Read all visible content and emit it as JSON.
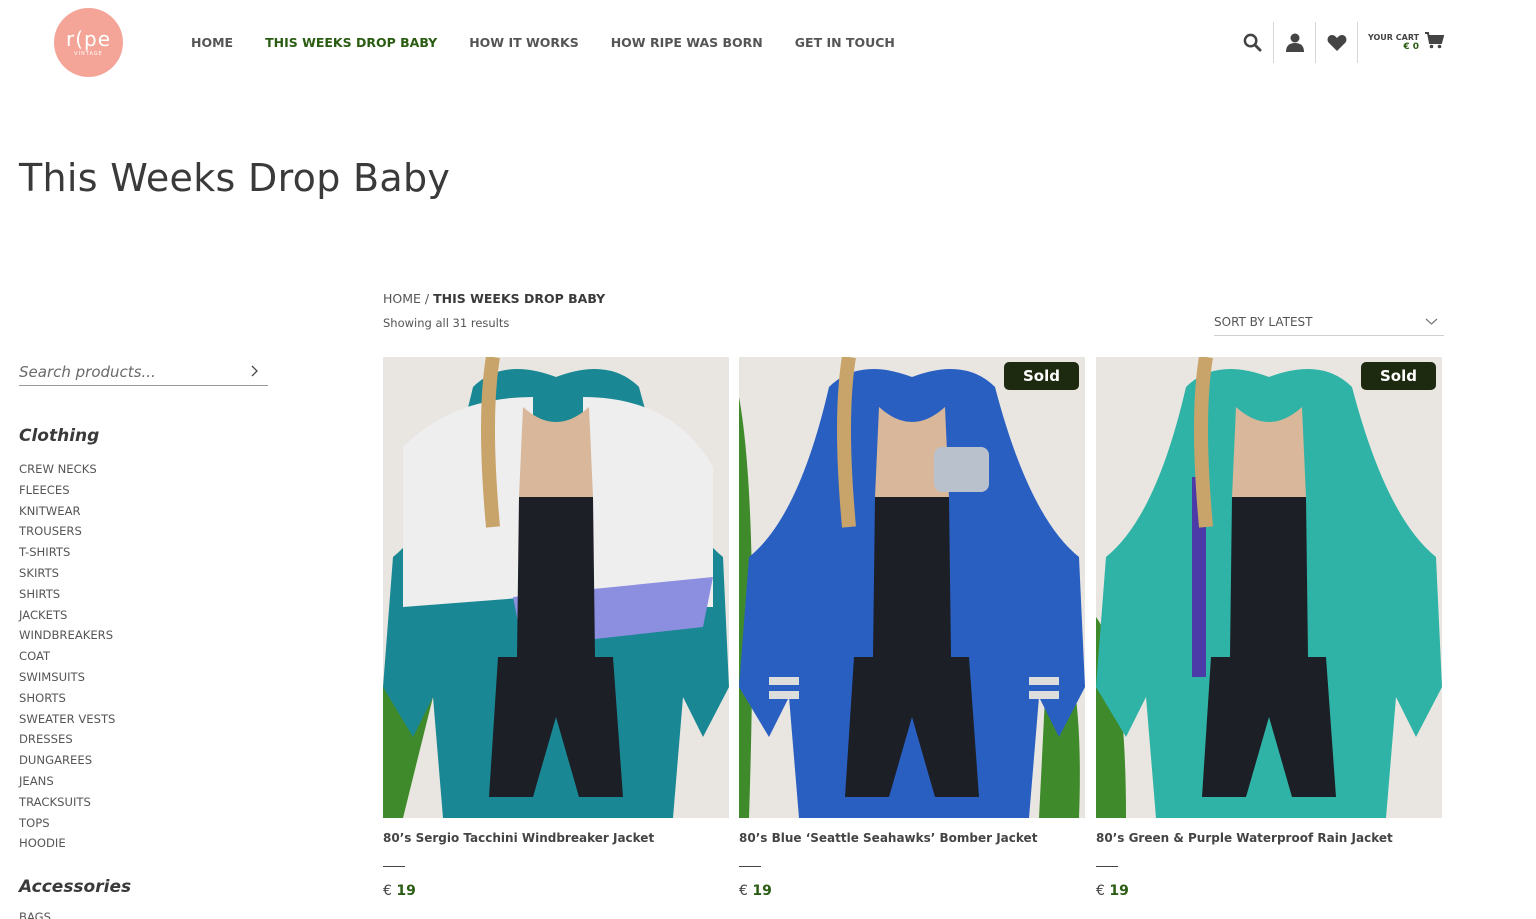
{
  "brand": {
    "logo_text": "r(pe",
    "logo_sub": "VINTAGE",
    "color": "#f4a598"
  },
  "nav": {
    "items": [
      "HOME",
      "THIS WEEKS DROP BABY",
      "HOW IT WORKS",
      "HOW RIPE WAS BORN",
      "GET IN TOUCH"
    ],
    "active_index": 1,
    "active_color": "#2a5c12"
  },
  "header": {
    "icons": [
      "search-icon",
      "user-icon",
      "heart-icon",
      "cart-icon"
    ],
    "cart_label": "YOUR CART",
    "cart_amount": "€ 0"
  },
  "page": {
    "title": "This Weeks Drop Baby"
  },
  "sidebar": {
    "search_placeholder": "Search products...",
    "clothing_heading": "Clothing",
    "clothing": [
      "CREW NECKS",
      "FLEECES",
      "KNITWEAR",
      "TROUSERS",
      "T-SHIRTS",
      "SKIRTS",
      "SHIRTS",
      "JACKETS",
      "WINDBREAKERS",
      "COAT",
      "SWIMSUITS",
      "SHORTS",
      "SWEATER VESTS",
      "DRESSES",
      "DUNGAREES",
      "JEANS",
      "TRACKSUITS",
      "TOPS",
      "HOODIE"
    ],
    "accessories_heading": "Accessories",
    "accessories": [
      "BAGS"
    ]
  },
  "main": {
    "breadcrumb_home": "HOME",
    "breadcrumb_sep": " / ",
    "breadcrumb_current": "THIS WEEKS DROP BABY",
    "results": "Showing all 31 results",
    "sort_label": "SORT BY LATEST"
  },
  "products": [
    {
      "title": "80’s Sergio Tacchini Windbreaker Jacket",
      "currency": "€",
      "price": "19",
      "sold": false,
      "sold_label": "",
      "jacket_color": "#1a8894",
      "jacket_color_2": "#eeeeee"
    },
    {
      "title": "80’s Blue ‘Seattle Seahawks’ Bomber Jacket",
      "currency": "€",
      "price": "19",
      "sold": true,
      "sold_label": "Sold",
      "jacket_color": "#2a5fc2",
      "jacket_color_2": "#2a5fc2"
    },
    {
      "title": "80’s Green & Purple Waterproof Rain Jacket",
      "currency": "€",
      "price": "19",
      "sold": true,
      "sold_label": "Sold",
      "jacket_color": "#2fb3a6",
      "jacket_color_2": "#2fb3a6"
    }
  ]
}
